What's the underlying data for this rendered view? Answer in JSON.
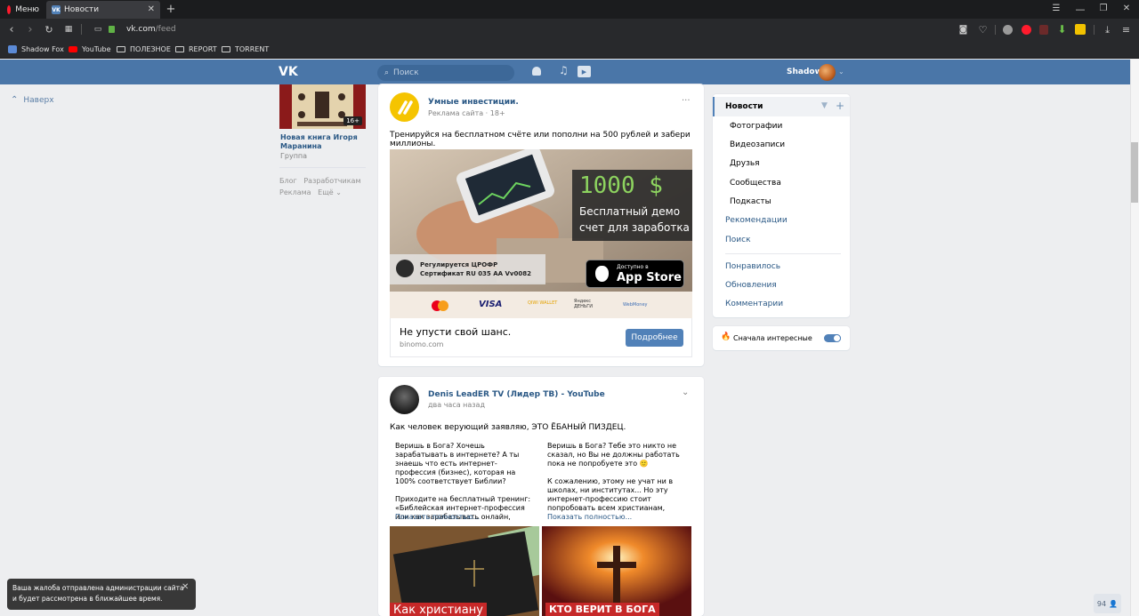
{
  "browser": {
    "menu_label": "Меню",
    "tab_title": "Новости",
    "vk_favicon": "VK",
    "new_tab": "+",
    "url_host": "vk.com",
    "url_path": "/feed",
    "bookmarks": [
      {
        "label": "Shadow Fox",
        "icon": "chat-icon"
      },
      {
        "label": "YouTube",
        "icon": "youtube-icon"
      },
      {
        "label": "ПОЛЕЗНОЕ",
        "icon": "folder-icon"
      },
      {
        "label": "REPORT",
        "icon": "folder-icon"
      },
      {
        "label": "TORRENT",
        "icon": "folder-icon"
      }
    ]
  },
  "vk": {
    "logo": "VK",
    "search_placeholder": "Поиск",
    "user_name": "Shadow",
    "back_to_top": "Наверх"
  },
  "left_group": {
    "title": "Новая книга Игоря Маранина",
    "subtitle": "Группа",
    "badge": "16+",
    "footer_links": [
      "Блог",
      "Разработчикам",
      "Реклама",
      "Ещё"
    ]
  },
  "post1": {
    "author": "Умные инвестиции.",
    "meta": "Реклама сайта · 18+",
    "more": "···",
    "text": "Тренируйся на бесплатном счёте или пополни на 500 рублей и забери миллионы.",
    "ad": {
      "amount": "1000 $",
      "line1": "Бесплатный демо",
      "line2": "счет для заработка",
      "reg1": "Регулируется ЦРОФР",
      "reg2": "Сертификат   RU 035 AA Vv0082",
      "store_small": "Доступно в",
      "store_big": "App Store",
      "payments": [
        "mastercard",
        "VISA",
        "QIWI WALLET",
        "Яндекс ДЕНЬГИ",
        "WebMoney"
      ]
    },
    "link_title": "Не упусти свой шанс.",
    "link_domain": "binomo.com",
    "button": "Подробнее"
  },
  "post2": {
    "author": "Denis LeadER TV (Лидер ТВ) - YouTube",
    "time": "два часа назад",
    "text": "Как человек верующий заявляю, ЭТО ЁБАНЫЙ ПИЗДЕЦ.",
    "col1": {
      "p1": "Веришь в Бога? Хочешь зарабатывать в интернете? А ты знаешь что есть интернет-профессия (бизнес), которая на 100% соответствует Библии?",
      "p2": "Приходите на бесплатный тренинг: «Библейская интернет-профессия или как зарабатывать онлайн,",
      "more": "Показать полностью..."
    },
    "col2": {
      "p1": "Веришь в Бога? Тебе это никто не сказал, но Вы не должны работать пока не попробуете это 🙂",
      "p2": "К сожалению, этому не учат ни в школах, ни институтах... Но эту интернет-профессию стоит попробовать всем христианам,",
      "more": "Показать полностью..."
    },
    "img1_caption": "Как христиану",
    "img2_caption": "КТО ВЕРИТ В БОГА"
  },
  "right_menu": {
    "active": "Новости",
    "subs": [
      "Фотографии",
      "Видеозаписи",
      "Друзья",
      "Сообщества",
      "Подкасты"
    ],
    "items": [
      "Рекомендации",
      "Поиск"
    ],
    "items2": [
      "Понравилось",
      "Обновления",
      "Комментарии"
    ],
    "toggle_label": "Сначала интересные"
  },
  "toast": {
    "line1": "Ваша жалоба отправлена администрации сайта",
    "line2": "и будет рассмотрена в ближайшее время."
  },
  "online_count": "94",
  "colors": {
    "vk_blue": "#4a76a8",
    "link": "#2a5885",
    "button": "#5181b8",
    "page_bg": "#edeef0",
    "ad_green": "#8dd35f"
  }
}
